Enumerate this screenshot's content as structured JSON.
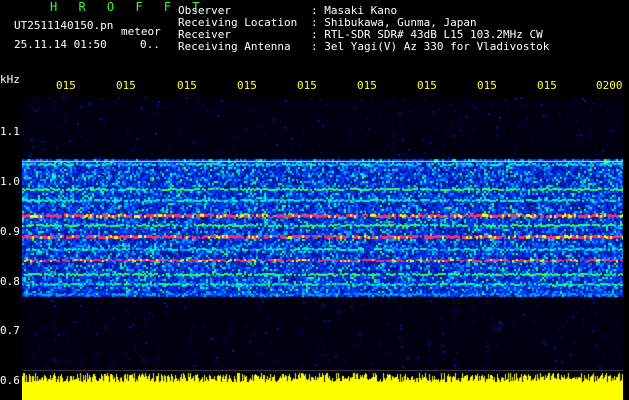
{
  "header": {
    "app_title": "H R O F F T",
    "file_name": "UT2511140150.pn",
    "meteor_label": "meteor",
    "datetime": "25.11.14 01:50",
    "count": "0..",
    "fields": [
      {
        "label": "Observer",
        "value": ": Masaki Kano"
      },
      {
        "label": "Receiving Location",
        "value": ": Shibukawa, Gunma, Japan"
      },
      {
        "label": "Receiver",
        "value": ": RTL-SDR SDR# 43dB L15 103.2MHz CW"
      },
      {
        "label": "Receiving Antenna",
        "value": ": 3el Yagi(V) Az 330 for Vladivostok"
      }
    ]
  },
  "axes": {
    "y_unit": "kHz",
    "y_ticks": [
      "1.1",
      "1.0",
      "0.9",
      "0.8",
      "0.7",
      "0.6"
    ],
    "x_ticks": [
      "015",
      "015",
      "015",
      "015",
      "015",
      "015",
      "015",
      "015",
      "015",
      "0200"
    ]
  },
  "colors": {
    "background": "#000000",
    "header_text": "#ffffff",
    "title": "#33ff33",
    "tick_labels": "#ffff44",
    "noise_floor": "#ffff00",
    "signal_hot": "#ff2266"
  }
}
